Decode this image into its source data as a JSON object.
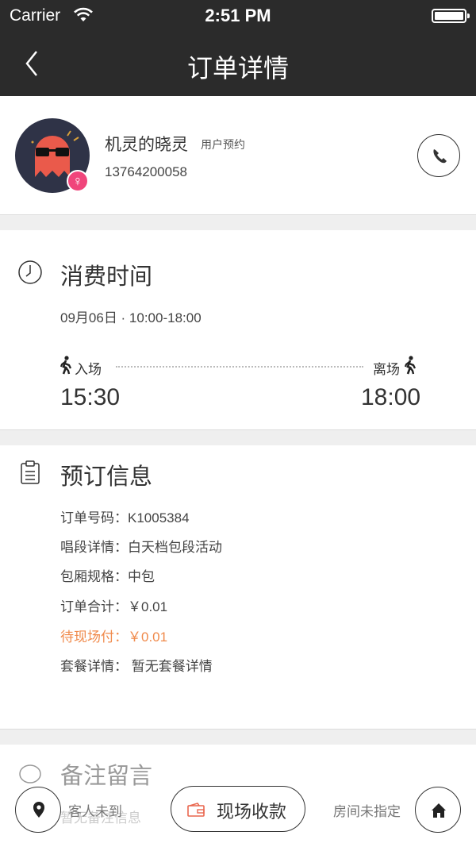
{
  "status_bar": {
    "carrier": "Carrier",
    "time": "2:51 PM"
  },
  "nav": {
    "title": "订单详情"
  },
  "user": {
    "name": "机灵的晓灵",
    "tag": "用户预约",
    "phone": "13764200058",
    "gender_symbol": "♀"
  },
  "consumption": {
    "title": "消费时间",
    "date": "09月06日 · 10:00-18:00",
    "enter_label": "入场",
    "leave_label": "离场",
    "enter_time": "15:30",
    "leave_time": "18:00"
  },
  "order": {
    "title": "预订信息",
    "rows": [
      {
        "text": "订单号码：K1005384"
      },
      {
        "text": "唱段详情：白天档包段活动"
      },
      {
        "text": "包厢规格：中包"
      },
      {
        "text": "订单合计：￥0.01"
      },
      {
        "text": "待现场付：￥0.01"
      },
      {
        "text": "套餐详情：    暂无套餐详情"
      }
    ]
  },
  "remark": {
    "title": "备注留言",
    "placeholder": "暂无备注信息"
  },
  "bottom": {
    "guest_status": "客人未到",
    "cash_label": "现场收款",
    "room_status": "房间未指定"
  },
  "colors": {
    "header": "#2b2b2b",
    "accent": "#f08a4b",
    "badge": "#f0457b",
    "avatar_bg": "#2f3347",
    "avatar_ghost": "#ea5a4b"
  }
}
